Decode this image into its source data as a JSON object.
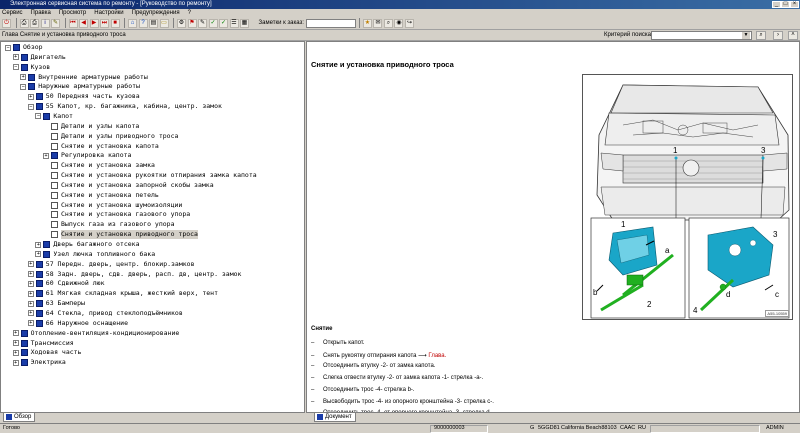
{
  "window": {
    "title": "Электронная сервисная система по ремонту - [Руководство по ремонту]"
  },
  "menu": [
    "Сервис",
    "Правка",
    "Просмотр",
    "Настройки",
    "Предупреждения",
    "?"
  ],
  "toolbar": {
    "icons": [
      {
        "name": "exit-icon",
        "glyph": "⏻",
        "color": "#c00000"
      },
      {
        "name": "print-icon",
        "glyph": "⎙",
        "color": "#000"
      },
      {
        "name": "print-preview-icon",
        "glyph": "⎙",
        "color": "#000"
      },
      {
        "name": "info-icon",
        "glyph": "i",
        "color": "#000080"
      },
      {
        "name": "pencil-icon",
        "glyph": "✎",
        "color": "#606000"
      },
      {
        "name": "rewind-icon",
        "glyph": "⏮",
        "color": "#c00000"
      },
      {
        "name": "back-icon",
        "glyph": "◀",
        "color": "#c00000"
      },
      {
        "name": "forward-icon",
        "glyph": "▶",
        "color": "#c00000"
      },
      {
        "name": "end-icon",
        "glyph": "⏭",
        "color": "#c00000"
      },
      {
        "name": "stop-icon",
        "glyph": "■",
        "color": "#c00000"
      },
      {
        "name": "home-icon",
        "glyph": "⌂",
        "color": "#0040c0"
      },
      {
        "name": "help-icon",
        "glyph": "?",
        "color": "#0040c0"
      },
      {
        "name": "document-icon",
        "glyph": "▤",
        "color": "#000"
      },
      {
        "name": "folder-icon",
        "glyph": "▭",
        "color": "#a08000"
      },
      {
        "name": "settings-icon",
        "glyph": "⚙",
        "color": "#000"
      },
      {
        "name": "bookmark-icon",
        "glyph": "⚑",
        "color": "#c00000"
      },
      {
        "name": "edit-icon",
        "glyph": "✎",
        "color": "#000"
      },
      {
        "name": "check-icon",
        "glyph": "✓",
        "color": "#008000"
      },
      {
        "name": "check-all-icon",
        "glyph": "✓",
        "color": "#008000"
      },
      {
        "name": "list-icon",
        "glyph": "☰",
        "color": "#000"
      },
      {
        "name": "grid-icon",
        "glyph": "▦",
        "color": "#000"
      },
      {
        "name": "star-icon",
        "glyph": "★",
        "color": "#c08000"
      },
      {
        "name": "mail-icon",
        "glyph": "✉",
        "color": "#000"
      },
      {
        "name": "search-icon",
        "glyph": "⌕",
        "color": "#000"
      },
      {
        "name": "camera-icon",
        "glyph": "◉",
        "color": "#000"
      },
      {
        "name": "exit-door-icon",
        "glyph": "↪",
        "color": "#000"
      }
    ],
    "order_label": "Заметки к заказ:"
  },
  "breadcrumb": "Глава Снятие и установка приводного троса",
  "search": {
    "label": "Критерий поиска:",
    "value": ""
  },
  "tree": [
    {
      "indent": 0,
      "exp": "−",
      "icon": "book",
      "label": "Обзор"
    },
    {
      "indent": 1,
      "exp": "+",
      "icon": "book",
      "label": "Двигатель"
    },
    {
      "indent": 1,
      "exp": "−",
      "icon": "book",
      "label": "Кузов"
    },
    {
      "indent": 2,
      "exp": "+",
      "icon": "book",
      "label": "Внутренние арматурные работы"
    },
    {
      "indent": 2,
      "exp": "−",
      "icon": "book",
      "label": "Наружные арматурные работы"
    },
    {
      "indent": 3,
      "exp": "+",
      "icon": "book",
      "label": "50 Передняя часть кузова"
    },
    {
      "indent": 3,
      "exp": "−",
      "icon": "book",
      "label": "55 Капот, кр. багажника, кабина, центр. замок"
    },
    {
      "indent": 4,
      "exp": "−",
      "icon": "book",
      "label": "Капот"
    },
    {
      "indent": 5,
      "exp": "",
      "icon": "doc",
      "label": "Детали и узлы капота"
    },
    {
      "indent": 5,
      "exp": "",
      "icon": "doc",
      "label": "Детали и узлы приводного троса"
    },
    {
      "indent": 5,
      "exp": "",
      "icon": "doc",
      "label": "Снятие и установка капота"
    },
    {
      "indent": 5,
      "exp": "+",
      "icon": "book",
      "label": "Регулировка капота"
    },
    {
      "indent": 5,
      "exp": "",
      "icon": "doc",
      "label": "Снятие и установка замка"
    },
    {
      "indent": 5,
      "exp": "",
      "icon": "doc",
      "label": "Снятие и установка рукоятки отпирания замка капота"
    },
    {
      "indent": 5,
      "exp": "",
      "icon": "doc",
      "label": "Снятие и установка запорной скобы замка"
    },
    {
      "indent": 5,
      "exp": "",
      "icon": "doc",
      "label": "Снятие и установка петель"
    },
    {
      "indent": 5,
      "exp": "",
      "icon": "doc",
      "label": "Снятие и установка шумоизоляции"
    },
    {
      "indent": 5,
      "exp": "",
      "icon": "doc",
      "label": "Снятие и установка газового упора"
    },
    {
      "indent": 5,
      "exp": "",
      "icon": "doc",
      "label": "Выпуск газа из газового упора"
    },
    {
      "indent": 5,
      "exp": "",
      "icon": "doc",
      "label": "Снятие и установка приводного троса",
      "selected": true
    },
    {
      "indent": 4,
      "exp": "+",
      "icon": "book",
      "label": "Дверь багажного отсека"
    },
    {
      "indent": 4,
      "exp": "+",
      "icon": "book",
      "label": "Узел лючка топливного бака"
    },
    {
      "indent": 3,
      "exp": "+",
      "icon": "book",
      "label": "57 Передн. дверь, центр. блокир.замков"
    },
    {
      "indent": 3,
      "exp": "+",
      "icon": "book",
      "label": "58 Задн. дверь, сдв. дверь, расп. дв, центр. замок"
    },
    {
      "indent": 3,
      "exp": "+",
      "icon": "book",
      "label": "60 Сдвижной люк"
    },
    {
      "indent": 3,
      "exp": "+",
      "icon": "book",
      "label": "61 Мягкая складная крыша, жесткий верх, тент"
    },
    {
      "indent": 3,
      "exp": "+",
      "icon": "book",
      "label": "63 Бамперы"
    },
    {
      "indent": 3,
      "exp": "+",
      "icon": "book",
      "label": "64 Стекла, привод стеклоподъёмников"
    },
    {
      "indent": 3,
      "exp": "+",
      "icon": "book",
      "label": "66 Наружное оснащение"
    },
    {
      "indent": 1,
      "exp": "+",
      "icon": "book",
      "label": "Отопление-вентиляция-кондиционирование"
    },
    {
      "indent": 1,
      "exp": "+",
      "icon": "book",
      "label": "Трансмиссия"
    },
    {
      "indent": 1,
      "exp": "+",
      "icon": "book",
      "label": "Ходовая часть"
    },
    {
      "indent": 1,
      "exp": "+",
      "icon": "book",
      "label": "Электрика"
    }
  ],
  "left_tab": "Обзор",
  "document": {
    "title": "Снятие и установка приводного троса",
    "figure_callouts": [
      "1",
      "3",
      "1",
      "a",
      "b",
      "2",
      "3",
      "4",
      "d",
      "c"
    ],
    "figure_id": "A55-10559",
    "section": "Снятие",
    "steps": [
      {
        "text": "Открыть капот."
      },
      {
        "text": "Снять рукоятку отпирания капота ⟶ ",
        "link": "Глава."
      },
      {
        "text": "Отсоединить втулку -2- от замка капота."
      },
      {
        "text": "Слегка отвести втулку -2- от замка капота -1- стрелка -a-."
      },
      {
        "text": "Отсоединить трос -4- стрелка b-."
      },
      {
        "text": "Высвободить трос -4- из опорного кронштейна -3- стрелка c-."
      },
      {
        "text": "Отсоединить трос -4- от опорного кронштейна -3- стрелка d-."
      }
    ],
    "tab": "Документ"
  },
  "status": {
    "ready": "Готово",
    "code": "9000000003",
    "g": "G",
    "model_code": "5GGD81",
    "model": "California Beach88103",
    "caac": "CAAC",
    "lang": "RU",
    "user": "ADMIN"
  },
  "colors": {
    "accent_blue": "#1a3ca8",
    "part_cyan": "#1aa6c8",
    "part_green": "#20b020",
    "link_red": "#c00000"
  }
}
